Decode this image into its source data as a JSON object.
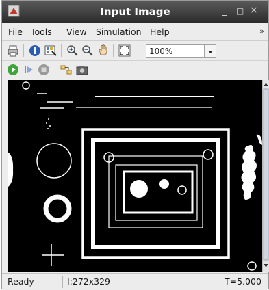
{
  "window": {
    "title": "Input Image",
    "minimize_glyph": "_",
    "maximize_glyph": "□",
    "close_glyph": "×"
  },
  "menu": {
    "items": [
      "File",
      "Tools",
      "View",
      "Simulation",
      "Help"
    ],
    "overflow_glyph": "»"
  },
  "toolbar": {
    "zoom_value": "100%",
    "icons": [
      "print-icon",
      "info-icon",
      "pixel-region-icon",
      "zoom-in-icon",
      "zoom-out-icon",
      "pan-hand-icon",
      "fit-to-window-icon"
    ]
  },
  "sim_toolbar": {
    "icons": [
      "run-icon",
      "step-forward-icon",
      "stop-icon",
      "highlight-model-icon",
      "snapshot-icon"
    ]
  },
  "status": {
    "state": "Ready",
    "image_info": "I:272x329",
    "time": "T=5.000"
  },
  "colors": {
    "titlebar": "#3a3a3a",
    "canvas_background": "#000000",
    "shape_color": "#ffffff",
    "run_green": "#3fa53a"
  }
}
